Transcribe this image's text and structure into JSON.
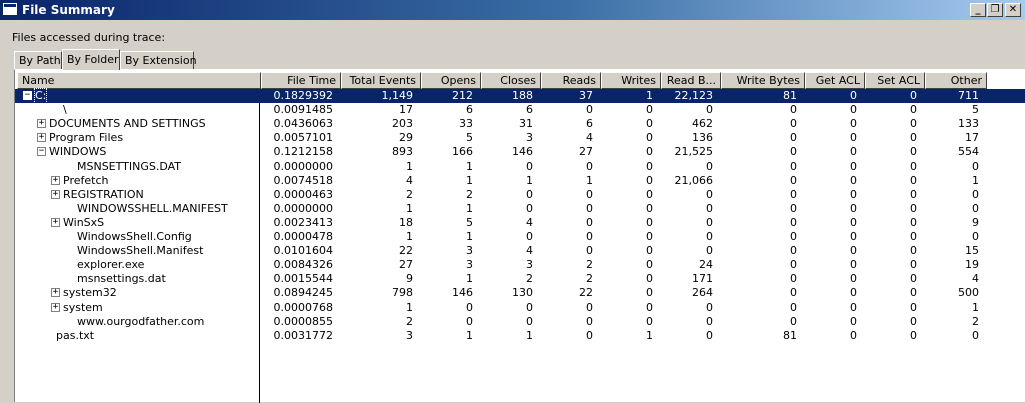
{
  "window": {
    "title": "File Summary",
    "buttons": {
      "minimize": "_",
      "restore": "❐",
      "close": "✕"
    }
  },
  "caption": "Files accessed during trace:",
  "tabs": [
    {
      "label": "By Path",
      "active": false
    },
    {
      "label": "By Folder",
      "active": true
    },
    {
      "label": "By Extension",
      "active": false
    }
  ],
  "columns": [
    "Name",
    "File Time",
    "Total Events",
    "Opens",
    "Closes",
    "Reads",
    "Writes",
    "Read B...",
    "Write Bytes",
    "Get ACL",
    "Set ACL",
    "Other"
  ],
  "rows": [
    {
      "name": "C:",
      "level": 0,
      "expander": "−",
      "selected": true,
      "values": [
        "0.1829392",
        "1,149",
        "212",
        "188",
        "37",
        "1",
        "22,123",
        "81",
        "0",
        "0",
        "711"
      ]
    },
    {
      "name": "\\",
      "level": 2,
      "expander": "",
      "values": [
        "0.0091485",
        "17",
        "6",
        "6",
        "0",
        "0",
        "0",
        "0",
        "0",
        "0",
        "5"
      ]
    },
    {
      "name": "DOCUMENTS AND SETTINGS",
      "level": 1,
      "expander": "+",
      "values": [
        "0.0436063",
        "203",
        "33",
        "31",
        "6",
        "0",
        "462",
        "0",
        "0",
        "0",
        "133"
      ]
    },
    {
      "name": "Program Files",
      "level": 1,
      "expander": "+",
      "values": [
        "0.0057101",
        "29",
        "5",
        "3",
        "4",
        "0",
        "136",
        "0",
        "0",
        "0",
        "17"
      ]
    },
    {
      "name": "WINDOWS",
      "level": 1,
      "expander": "−",
      "values": [
        "0.1212158",
        "893",
        "166",
        "146",
        "27",
        "0",
        "21,525",
        "0",
        "0",
        "0",
        "554"
      ]
    },
    {
      "name": "MSNSETTINGS.DAT",
      "level": 3,
      "expander": "",
      "values": [
        "0.0000000",
        "1",
        "1",
        "0",
        "0",
        "0",
        "0",
        "0",
        "0",
        "0",
        "0"
      ]
    },
    {
      "name": "Prefetch",
      "level": 2,
      "expander": "+",
      "values": [
        "0.0074518",
        "4",
        "1",
        "1",
        "1",
        "0",
        "21,066",
        "0",
        "0",
        "0",
        "1"
      ]
    },
    {
      "name": "REGISTRATION",
      "level": 2,
      "expander": "+",
      "values": [
        "0.0000463",
        "2",
        "2",
        "0",
        "0",
        "0",
        "0",
        "0",
        "0",
        "0",
        "0"
      ]
    },
    {
      "name": "WINDOWSSHELL.MANIFEST",
      "level": 3,
      "expander": "",
      "values": [
        "0.0000000",
        "1",
        "1",
        "0",
        "0",
        "0",
        "0",
        "0",
        "0",
        "0",
        "0"
      ]
    },
    {
      "name": "WinSxS",
      "level": 2,
      "expander": "+",
      "values": [
        "0.0023413",
        "18",
        "5",
        "4",
        "0",
        "0",
        "0",
        "0",
        "0",
        "0",
        "9"
      ]
    },
    {
      "name": "WindowsShell.Config",
      "level": 3,
      "expander": "",
      "values": [
        "0.0000478",
        "1",
        "1",
        "0",
        "0",
        "0",
        "0",
        "0",
        "0",
        "0",
        "0"
      ]
    },
    {
      "name": "WindowsShell.Manifest",
      "level": 3,
      "expander": "",
      "values": [
        "0.0101604",
        "22",
        "3",
        "4",
        "0",
        "0",
        "0",
        "0",
        "0",
        "0",
        "15"
      ]
    },
    {
      "name": "explorer.exe",
      "level": 3,
      "expander": "",
      "values": [
        "0.0084326",
        "27",
        "3",
        "3",
        "2",
        "0",
        "24",
        "0",
        "0",
        "0",
        "19"
      ]
    },
    {
      "name": "msnsettings.dat",
      "level": 3,
      "expander": "",
      "values": [
        "0.0015544",
        "9",
        "1",
        "2",
        "2",
        "0",
        "171",
        "0",
        "0",
        "0",
        "4"
      ]
    },
    {
      "name": "system32",
      "level": 2,
      "expander": "+",
      "values": [
        "0.0894245",
        "798",
        "146",
        "130",
        "22",
        "0",
        "264",
        "0",
        "0",
        "0",
        "500"
      ]
    },
    {
      "name": "system",
      "level": 2,
      "expander": "+",
      "values": [
        "0.0000768",
        "1",
        "0",
        "0",
        "0",
        "0",
        "0",
        "0",
        "0",
        "0",
        "1"
      ]
    },
    {
      "name": "www.ourgodfather.com",
      "level": 3,
      "expander": "",
      "values": [
        "0.0000855",
        "2",
        "0",
        "0",
        "0",
        "0",
        "0",
        "0",
        "0",
        "0",
        "2"
      ]
    },
    {
      "name": "pas.txt",
      "level": 1.5,
      "expander": "",
      "values": [
        "0.0031772",
        "3",
        "1",
        "1",
        "0",
        "1",
        "0",
        "81",
        "0",
        "0",
        "0"
      ]
    }
  ]
}
